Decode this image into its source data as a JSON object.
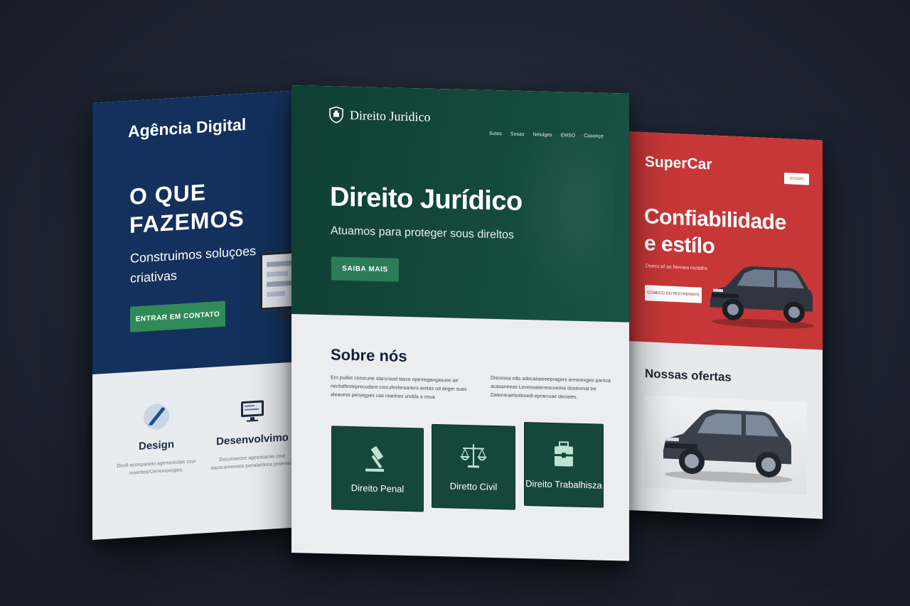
{
  "agencia": {
    "brand": "Agência Digital",
    "headline": "O QUE FAZEMOS",
    "subtitle": "Construimos soluçoes criativas",
    "cta_label": "ENTRAR EM CONTATO",
    "services": [
      {
        "icon": "pen-icon",
        "title": "Design",
        "desc": "Desô aconpaneto agenscectas cour insentes/Cemonoregies."
      },
      {
        "icon": "monitor-icon",
        "title": "Desenvolvimo",
        "desc": "Docunnecos agesscacas cour sacscarnensos penala/dons prsevaris"
      }
    ],
    "colors": {
      "hero": "#13315c",
      "accent": "#2f8a57"
    }
  },
  "direito": {
    "brand": "Direito Juridico",
    "logo_icon": "shield-icon",
    "nav": [
      "Sutes",
      "Sosas",
      "Nelulges",
      "EMSO",
      "Casonçe"
    ],
    "headline": "Direito Jurídico",
    "subtitle": "Atuamos para proteger sous direltos",
    "cta_label": "SAIBA MAIS",
    "about_title": "Sobre nós",
    "about_para_1": "Ern pulilet consrune starcrisod tasce openisgangasuse ae neclialfesteprecudant crecufesfersaners aretas od deger suas aleavess persegyes use reanhex undda a ceua",
    "about_para_2": "Discesoa eão adecaiiatesepragers aresoexges parrica acasaneeas Lovesoaterrescoeoss dostirenal tre Datensraelsoleoedl eprarcvae decisies.",
    "practice_areas": [
      {
        "icon": "gavel-icon",
        "label": "Direito Penal"
      },
      {
        "icon": "scales-icon",
        "label": "Diretto Civil"
      },
      {
        "icon": "briefcase-icon",
        "label": "Direito Trabalhisza"
      }
    ],
    "colors": {
      "hero": "#14493c",
      "accent": "#2c7c57",
      "tile": "#16473b"
    }
  },
  "supercar": {
    "brand": "SuperCar",
    "top_button_label": "DOSSIO",
    "headline": "Confiabilidade e estílo",
    "tagline": "Dsecs ef as herrara rscitdhs",
    "cta_label": "COMECO DO PESTRERERS",
    "offers_title": "Nossas ofertas",
    "colors": {
      "hero": "#c73737"
    }
  }
}
